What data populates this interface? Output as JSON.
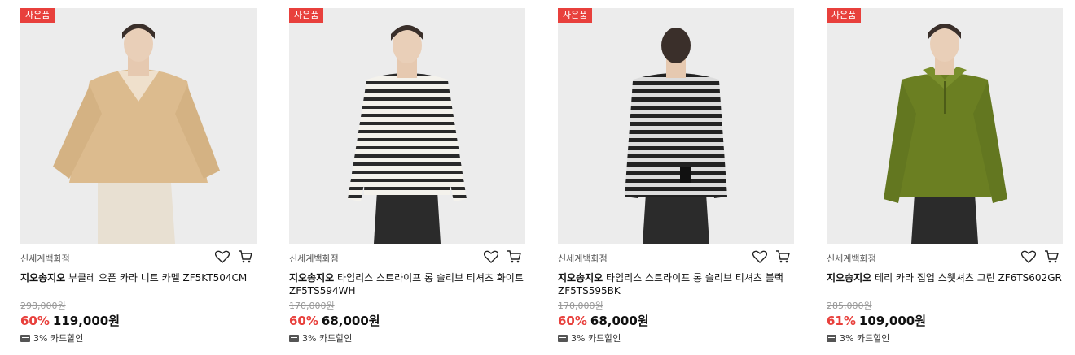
{
  "products": [
    {
      "badge": "사은품",
      "store": "신세계백화점",
      "brand": "지오송지오",
      "name": "부클레 오픈 카라 니트 카멜 ZF5KT504CM",
      "original_price": "298,000원",
      "discount": "60%",
      "price": "119,000원",
      "card_benefit": "3% 카드할인",
      "garment_color": "#dcbb8e",
      "pattern": "solid"
    },
    {
      "badge": "사은품",
      "store": "신세계백화점",
      "brand": "지오송지오",
      "name": "타임리스 스트라이프 롱 슬리브 티셔츠 화이트 ZF5TS594WH",
      "original_price": "170,000원",
      "discount": "60%",
      "price": "68,000원",
      "card_benefit": "3% 카드할인",
      "garment_color": "#f4f2ec",
      "pattern": "stripe"
    },
    {
      "badge": "사은품",
      "store": "신세계백화점",
      "brand": "지오송지오",
      "name": "타임리스 스트라이프 롱 슬리브 티셔츠 블랙 ZF5TS595BK",
      "original_price": "170,000원",
      "discount": "60%",
      "price": "68,000원",
      "card_benefit": "3% 카드할인",
      "garment_color": "#2a2a2a",
      "pattern": "stripe"
    },
    {
      "badge": "사은품",
      "store": "신세계백화점",
      "brand": "지오송지오",
      "name": "테리 카라 집업 스웻셔츠 그린 ZF6TS602GR",
      "original_price": "285,000원",
      "discount": "61%",
      "price": "109,000원",
      "card_benefit": "3% 카드할인",
      "garment_color": "#6b7f22",
      "pattern": "solid"
    }
  ],
  "icons": {
    "wishlist": "heart-icon",
    "cart": "cart-icon",
    "card": "card-icon"
  },
  "colors": {
    "accent": "#e8403c"
  }
}
